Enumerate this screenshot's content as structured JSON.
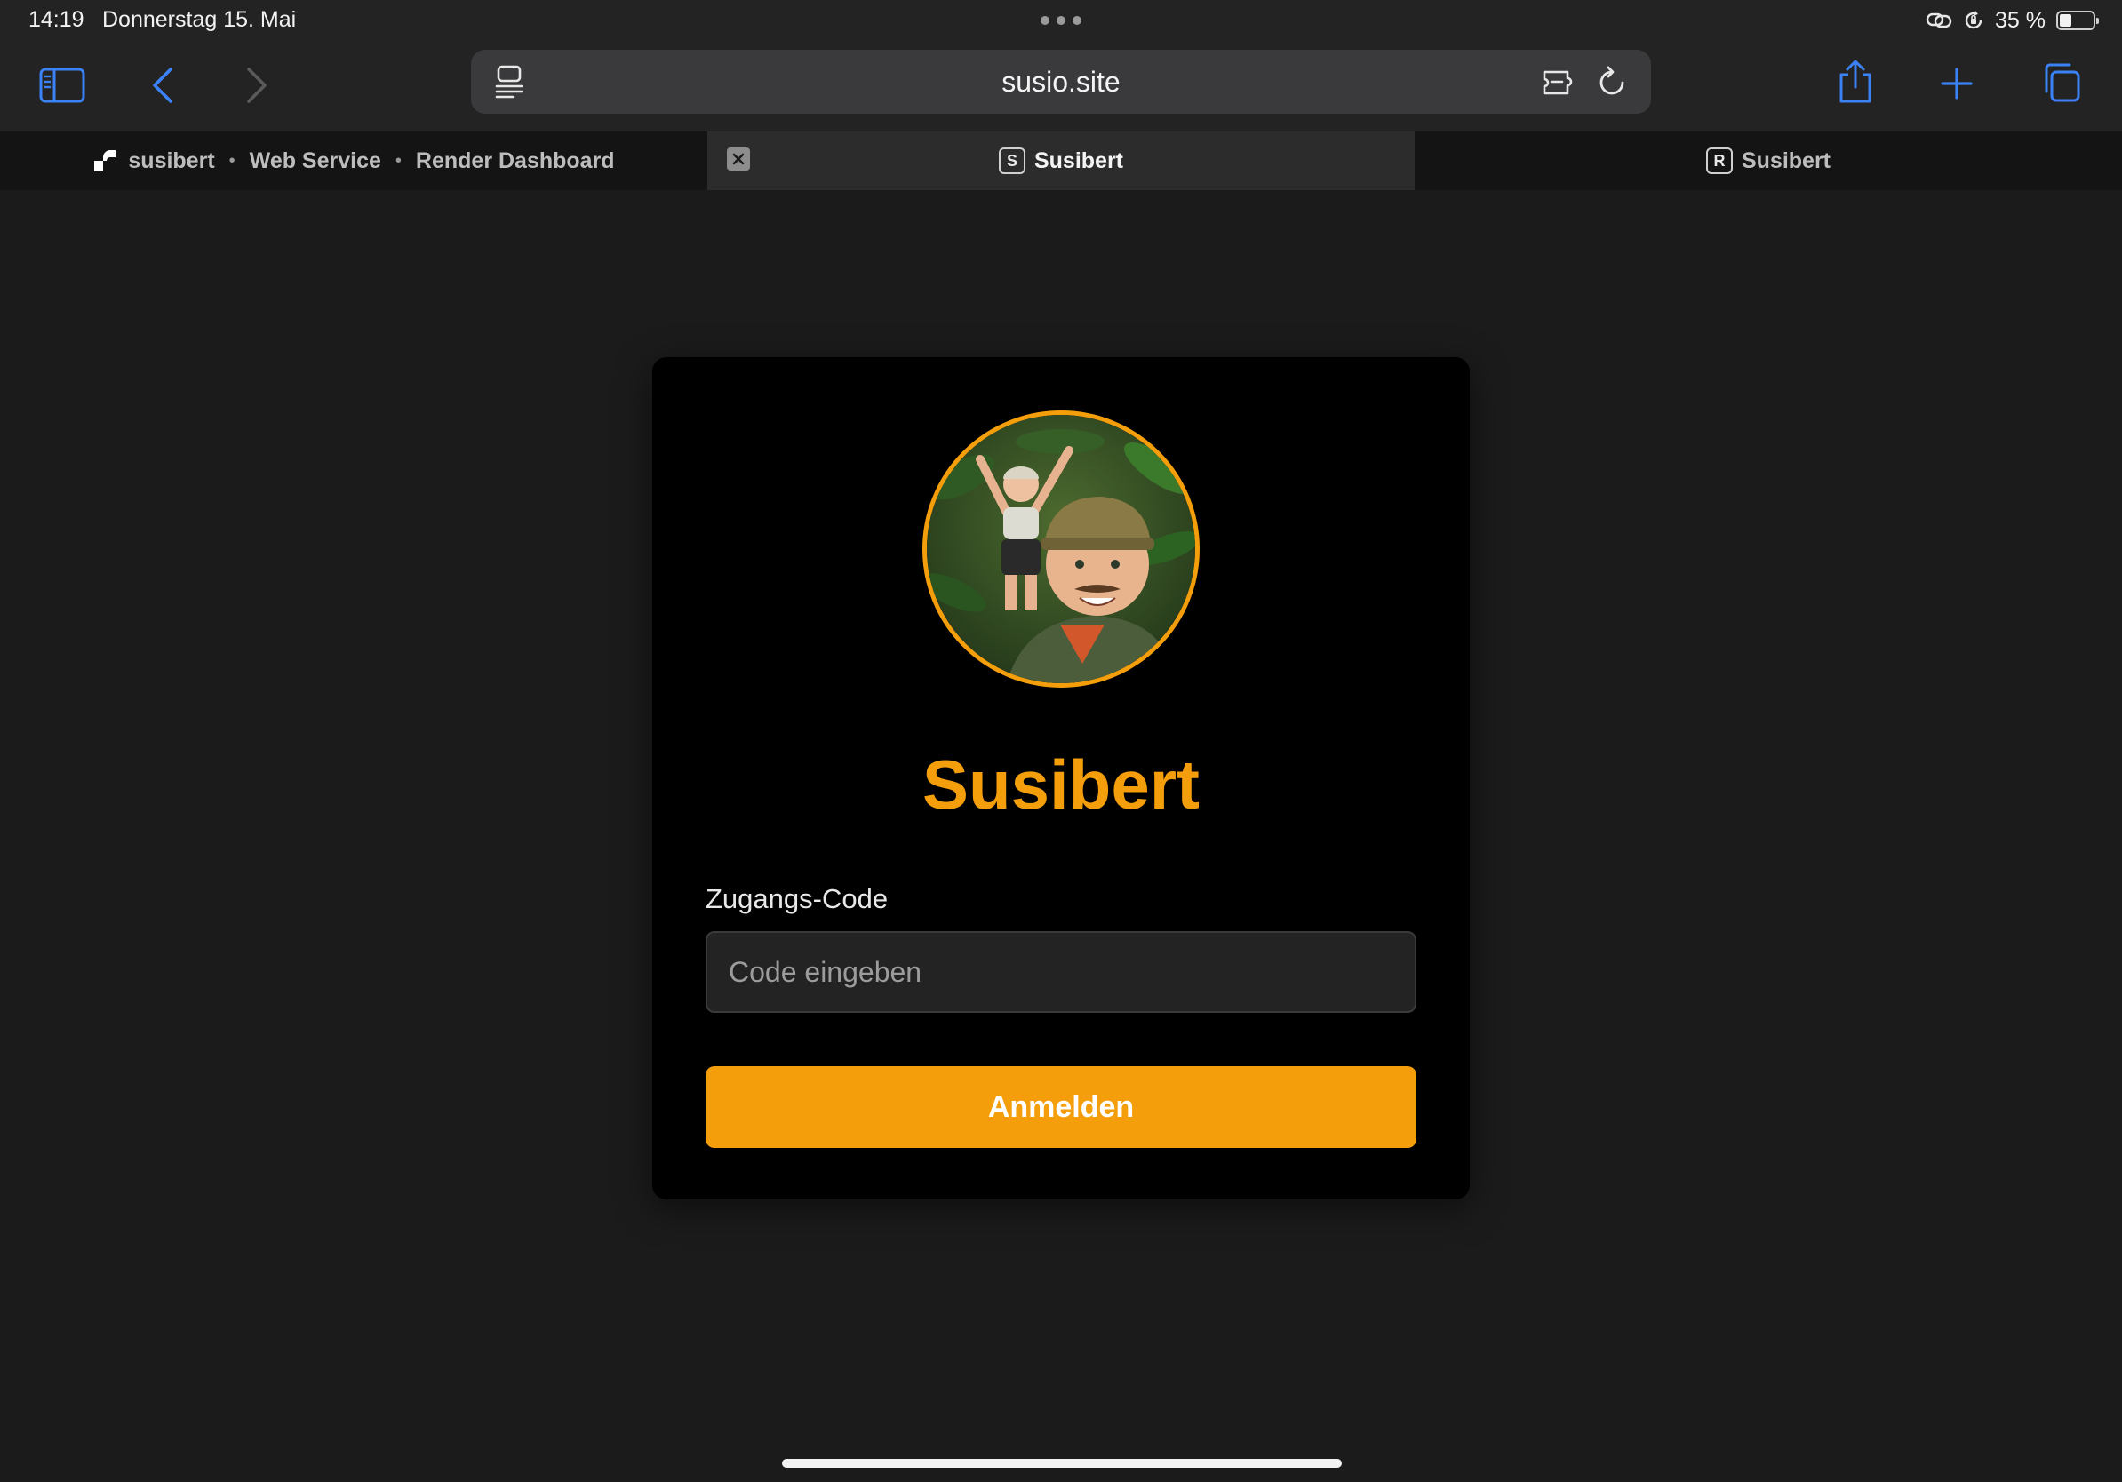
{
  "status_bar": {
    "time": "14:19",
    "date": "Donnerstag 15. Mai",
    "battery_percent": "35 %",
    "battery_level": 0.35
  },
  "browser": {
    "url": "susio.site",
    "accent_color": "#3b82f6"
  },
  "tabs": [
    {
      "parts": [
        "susibert",
        "Web Service",
        "Render Dashboard"
      ],
      "separator": "•",
      "active": false
    },
    {
      "favicon_letter": "S",
      "label": "Susibert",
      "active": true
    },
    {
      "favicon_letter": "R",
      "label": "Susibert",
      "active": false
    }
  ],
  "login": {
    "title": "Susibert",
    "code_label": "Zugangs-Code",
    "code_placeholder": "Code eingeben",
    "code_value": "",
    "submit_label": "Anmelden",
    "brand_color": "#f59e0b"
  }
}
